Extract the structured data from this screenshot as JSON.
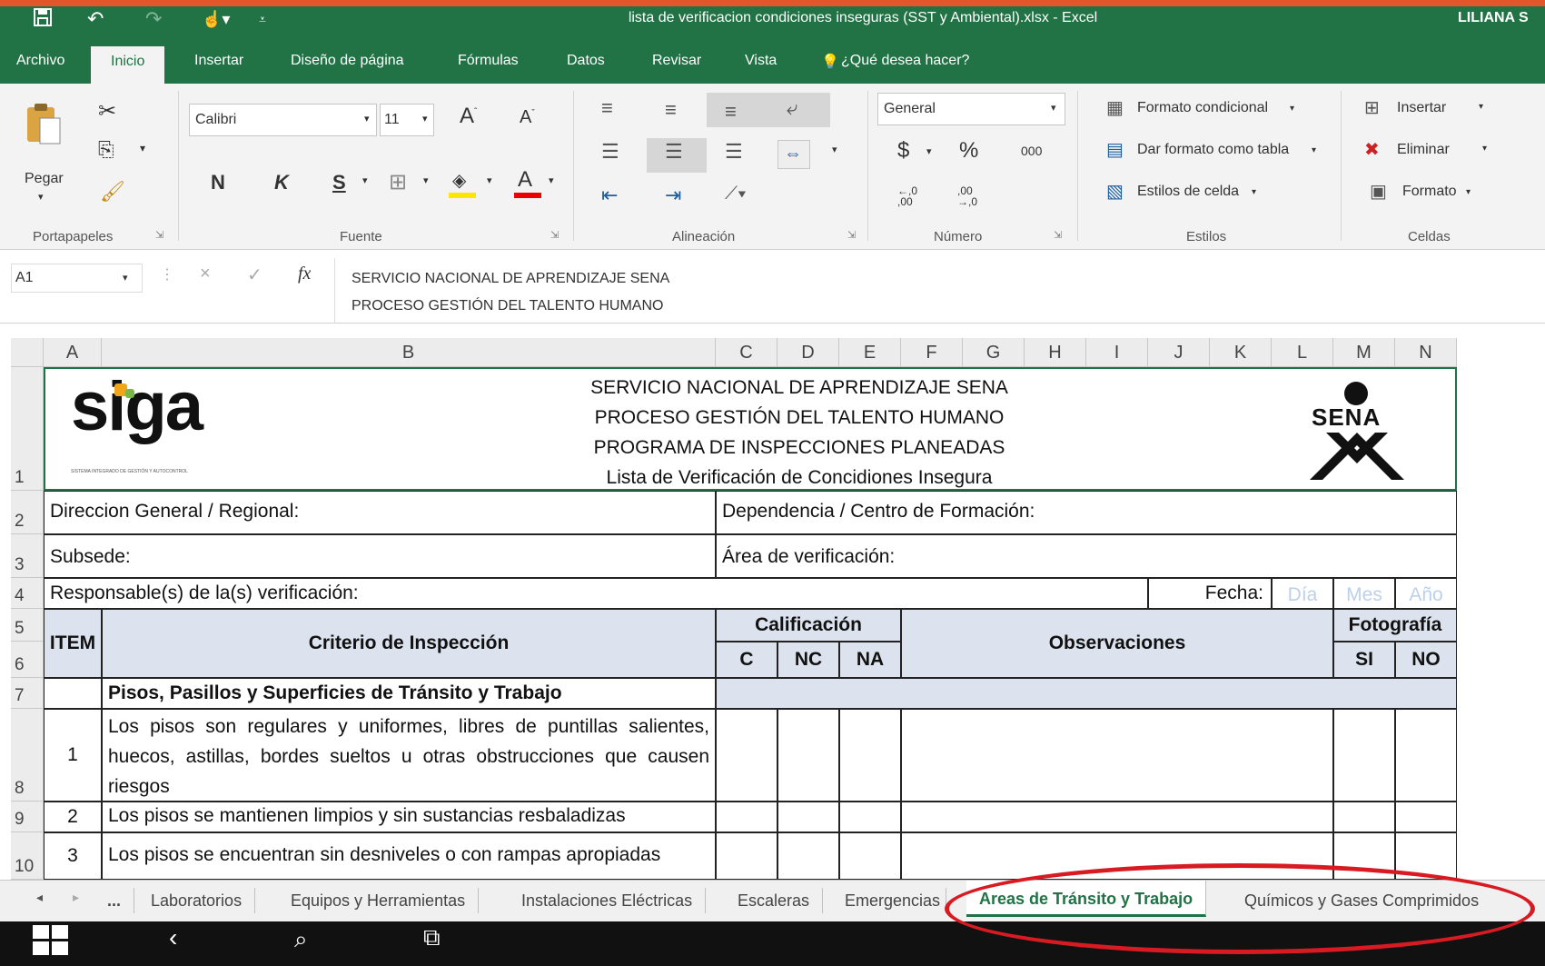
{
  "window": {
    "title": "lista de verificacion condiciones inseguras (SST y Ambiental).xlsx - Excel",
    "user": "LILIANA S"
  },
  "ribbon_tabs": [
    "Archivo",
    "Inicio",
    "Insertar",
    "Diseño de página",
    "Fórmulas",
    "Datos",
    "Revisar",
    "Vista"
  ],
  "tell_me": "¿Qué desea hacer?",
  "ribbon": {
    "paste_label": "Pegar",
    "font_name": "Calibri",
    "font_size": "11",
    "bold": "N",
    "italic": "K",
    "underline": "S",
    "number_format": "General",
    "currency": "$",
    "percent": "%",
    "thousands": "000",
    "inc_decimal": "←,0 ,00",
    "dec_decimal": ",00 →,0",
    "styles": [
      "Formato condicional",
      "Dar formato como tabla",
      "Estilos de celda"
    ],
    "cells": [
      "Insertar",
      "Eliminar",
      "Formato"
    ],
    "groups": [
      "Portapapeles",
      "Fuente",
      "Alineación",
      "Número",
      "Estilos",
      "Celdas"
    ]
  },
  "formula_bar": {
    "name_box": "A1",
    "fx": "fx",
    "line1": "SERVICIO NACIONAL DE APRENDIZAJE SENA",
    "line2": "PROCESO GESTIÓN DEL TALENTO HUMANO"
  },
  "columns": [
    "A",
    "B",
    "C",
    "D",
    "E",
    "F",
    "G",
    "H",
    "I",
    "J",
    "K",
    "L",
    "M",
    "N"
  ],
  "rows": [
    "1",
    "2",
    "3",
    "4",
    "5",
    "6",
    "7",
    "8",
    "9",
    "10"
  ],
  "sheet": {
    "logo_left": "siga",
    "logo_left_caption": "SISTEMA INTEGRADO DE GESTIÓN Y AUTOCONTROL",
    "logo_right": "SENA",
    "header_lines": [
      "SERVICIO NACIONAL DE APRENDIZAJE SENA",
      "PROCESO GESTIÓN DEL TALENTO HUMANO",
      "PROGRAMA DE INSPECCIONES PLANEADAS",
      "Lista de Verificación de Concidiones Insegura"
    ],
    "direccion": "Direccion General / Regional:",
    "dependencia": "Dependencia / Centro de Formación:",
    "subsede": "Subsede:",
    "area": "Área de verificación:",
    "responsable": "Responsable(s) de la(s) verificación:",
    "fecha": "Fecha:",
    "dia": "Día",
    "mes": "Mes",
    "anio": "Año",
    "item": "ITEM",
    "criterio": "Criterio de Inspección",
    "calificacion": "Calificación",
    "c": "C",
    "nc": "NC",
    "na": "NA",
    "observaciones": "Observaciones",
    "fotografia": "Fotografía",
    "si": "SI",
    "no": "NO",
    "section": "Pisos, Pasillos y Superficies de Tránsito y Trabajo",
    "items": [
      {
        "num": "1",
        "text": "Los pisos son regulares y uniformes, libres de puntillas salientes, huecos, astillas, bordes sueltos u otras obstrucciones que causen riesgos"
      },
      {
        "num": "2",
        "text": "Los pisos se mantienen limpios y sin sustancias resbaladizas"
      },
      {
        "num": "3",
        "text": "Los pisos se encuentran sin desniveles o con rampas apropiadas"
      }
    ]
  },
  "sheet_tabs": [
    "...",
    "Laboratorios",
    "Equipos y Herramientas",
    "Instalaciones Eléctricas",
    "Escaleras",
    "Emergencias",
    "Areas de Tránsito y Trabajo",
    "Químicos y Gases Comprimidos"
  ],
  "active_sheet_index": 6,
  "colors": {
    "excel_green": "#217346",
    "header_blue": "#dce3ee",
    "highlight_red": "#d81b23",
    "accent_orange": "#e2572a"
  }
}
